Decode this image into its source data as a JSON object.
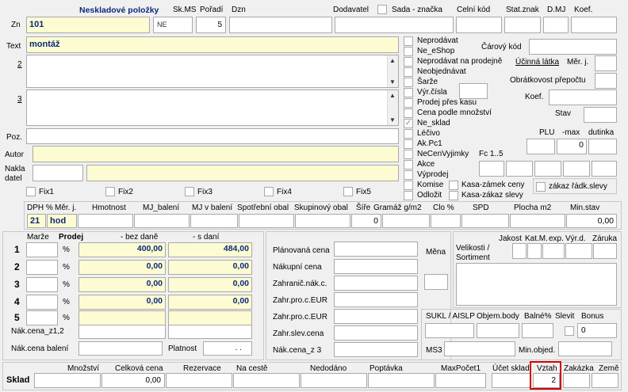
{
  "top": {
    "title": "Neskladové položky",
    "skms": "Sk.MS",
    "poradi": "Pořadí",
    "dzn": "Dzn",
    "dodavatel": "Dodavatel",
    "sada": "Sada - značka",
    "celni": "Celní kód",
    "statznak": "Stat.znak",
    "dmj": "D.MJ",
    "koef": "Koef."
  },
  "zn": {
    "label": "Zn",
    "value": "101",
    "skms": "NE",
    "poradi": "5"
  },
  "text": {
    "label": "Text",
    "value": "montáž",
    "label2": "2",
    "label3": "3"
  },
  "poz": "Poz.",
  "autor": "Autor",
  "nakladatel": "Nakla\ndatel",
  "fix": [
    "Fix1",
    "Fix2",
    "Fix3",
    "Fix4",
    "Fix5"
  ],
  "flags": {
    "neprodavat": "Neprodávat",
    "ne_eshop": "Ne_eShop",
    "neprodavat_prodejne": "Neprodávat na prodejně",
    "neobjednavat": "Neobjednávat",
    "sarze": "Šarže",
    "vyrcisla": "Výr.čísla",
    "prodej_pres_kasu": "Prodej přes kasu",
    "cena_podle": "Cena podle množství",
    "ne_sklad": "Ne_sklad",
    "lecivo": "Léčivo",
    "akpc1": "Ak.Pc1",
    "necenvyjimky": "NeCenVyjimky",
    "fc": "Fc 1..5",
    "akce": "Akce",
    "vyprodej": "Výprodej",
    "komise": "Komise",
    "odlozit": "Odložit",
    "kasa_zamek": "Kasa-zámek ceny",
    "kasa_zakaz": "Kasa-zákaz slevy",
    "zakaz_radk": "zákaz řádk.slevy"
  },
  "right": {
    "carovy": "Čárový kód",
    "ucinna": "Účinná látka",
    "merj": "Měr. j.",
    "obratkovost": "Obrátkovost přepočtu",
    "koef": "Koef.",
    "stav": "Stav",
    "plu": "PLU",
    "max": "-max",
    "dutinka": "dutinka",
    "max_value": "0"
  },
  "dph": {
    "headers": [
      "DPH %",
      "Měr. j.",
      "Hmotnost",
      "MJ_balení",
      "MJ v balení",
      "Spotřební obal",
      "Skupinový obal",
      "Šíře",
      "Gramáž g/m2",
      "Clo %",
      "SPD",
      "Plocha m2",
      "Min.stav"
    ],
    "dph_value": "21",
    "mj_value": "hod",
    "sire_value": "0",
    "minstav_value": "0,00"
  },
  "prices": {
    "marze": "Marže",
    "prodej": "Prodej",
    "bez_dane": "- bez daně",
    "s_dani": "- s daní",
    "rows": [
      {
        "n": "1",
        "pct": "%",
        "bez": "400,00",
        "s": "484,00"
      },
      {
        "n": "2",
        "pct": "%",
        "bez": "0,00",
        "s": "0,00"
      },
      {
        "n": "3",
        "pct": "%",
        "bez": "0,00",
        "s": "0,00"
      },
      {
        "n": "4",
        "pct": "%",
        "bez": "0,00",
        "s": "0,00"
      },
      {
        "n": "5",
        "pct": "%",
        "bez": "",
        "s": ""
      }
    ],
    "nakcena_z12": "Nák.cena_z1,2",
    "nakcena_baleni": "Nák.cena balení",
    "platnost": "Platnost",
    "platnost_value": ". ."
  },
  "mid": {
    "planovana": "Plánovaná cena",
    "nakupni": "Nákupní cena",
    "zahranic": "Zahranič.nák.c.",
    "zahr_pro_eur": "Zahr.pro.c.EUR",
    "zahr_pro_eur2": "Zahr.pro.c.EUR",
    "zahr_slev": "Zahr.slev.cena",
    "nakcena_z3": "Nák.cena_z 3",
    "mena": "Měna"
  },
  "velikosti": {
    "label": "Velikosti /\nSortiment",
    "jakost": "Jakost",
    "katm": "Kat.M.",
    "exp": "exp.",
    "vyrd": "Výr.d.",
    "zaruka": "Záruka"
  },
  "sukl": {
    "label": "SUKL / AISLP",
    "objem": "Objem.body",
    "balne": "Balné%",
    "slevit": "Slevit",
    "bonus": "Bonus",
    "bonus_value": "0",
    "ms3": "MS3",
    "minobjed": "Min.objed."
  },
  "sklad": {
    "label": "Sklad",
    "mnozstvi": "Množství",
    "celkova": "Celková cena",
    "rezervace": "Rezervace",
    "naceste": "Na cestě",
    "nedodano": "Nedodáno",
    "poptavka": "Poptávka",
    "maxpocet": "MaxPočet1",
    "ucet": "Účet sklad",
    "vztah": "Vztah",
    "zakazka": "Zakázka",
    "zeme": "Země",
    "celkova_value": "0,00",
    "vztah_value": "2"
  }
}
